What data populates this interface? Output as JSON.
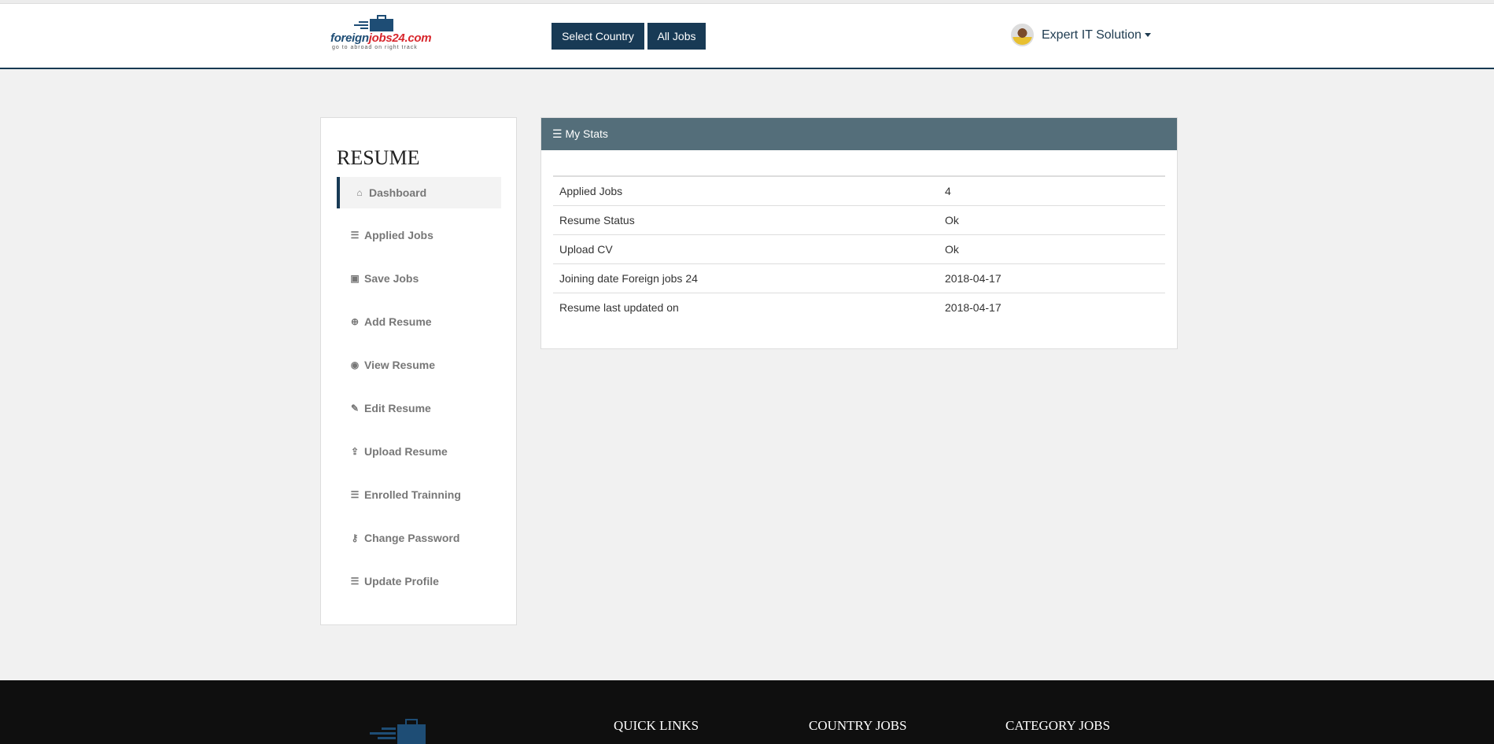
{
  "header": {
    "logo_brand_a": "foreign",
    "logo_brand_b": "jobs24.com",
    "logo_tagline": "go to abroad on right track",
    "select_country": "Select Country",
    "all_jobs": "All Jobs",
    "user_name": "Expert IT Solution"
  },
  "sidebar": {
    "title": "RESUME",
    "items": [
      {
        "label": "Dashboard",
        "icon": "home-icon"
      },
      {
        "label": "Applied Jobs",
        "icon": "list-icon"
      },
      {
        "label": "Save Jobs",
        "icon": "save-icon"
      },
      {
        "label": "Add Resume",
        "icon": "plus-circle-icon"
      },
      {
        "label": "View Resume",
        "icon": "eye-icon"
      },
      {
        "label": "Edit Resume",
        "icon": "edit-icon"
      },
      {
        "label": "Upload Resume",
        "icon": "upload-icon"
      },
      {
        "label": "Enrolled Trainning",
        "icon": "list-icon"
      },
      {
        "label": "Change Password",
        "icon": "key-icon"
      },
      {
        "label": "Update Profile",
        "icon": "list-icon"
      }
    ]
  },
  "stats": {
    "title": "My Stats",
    "rows": [
      {
        "label": "Applied Jobs",
        "value": "4"
      },
      {
        "label": "Resume Status",
        "value": "Ok"
      },
      {
        "label": "Upload CV",
        "value": "Ok"
      },
      {
        "label": "Joining date Foreign jobs 24",
        "value": "2018-04-17"
      },
      {
        "label": "Resume last updated on",
        "value": "2018-04-17"
      }
    ]
  },
  "footer": {
    "quick_links": "QUICK LINKS",
    "country_jobs": "COUNTRY JOBS",
    "category_jobs": "CATEGORY JOBS"
  }
}
